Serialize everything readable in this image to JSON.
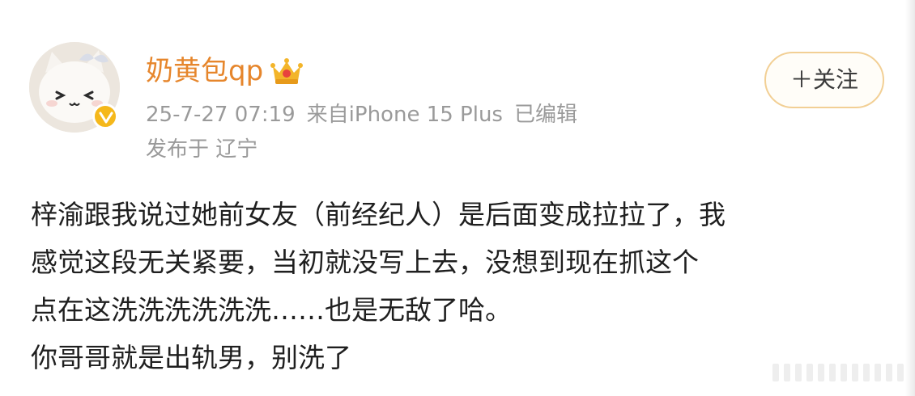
{
  "post": {
    "author": {
      "name": "奶黄包qp",
      "avatar_icon": "cartoon-cat-avatar-icon",
      "badge_icon": "verified-v-icon",
      "level_icon": "crown-icon"
    },
    "meta": {
      "timestamp": "25-7-27 07:19",
      "source": "来自iPhone 15 Plus",
      "edited": "已编辑",
      "location": "发布于 辽宁"
    },
    "follow_button_label": "＋关注",
    "content_lines": [
      "梓渝跟我说过她前女友（前经纪人）是后面变成拉拉了，我",
      "感觉这段无关紧要，当初就没写上去，没想到现在抓这个",
      "点在这洗洗洗洗洗洗……也是无敌了哈。",
      "你哥哥就是出轨男，别洗了"
    ]
  },
  "colors": {
    "username": "#e6862c",
    "meta": "#9a9a9a",
    "text": "#1f1f1f",
    "follow_border": "#f2cf94",
    "badge": "#f5b81b"
  }
}
